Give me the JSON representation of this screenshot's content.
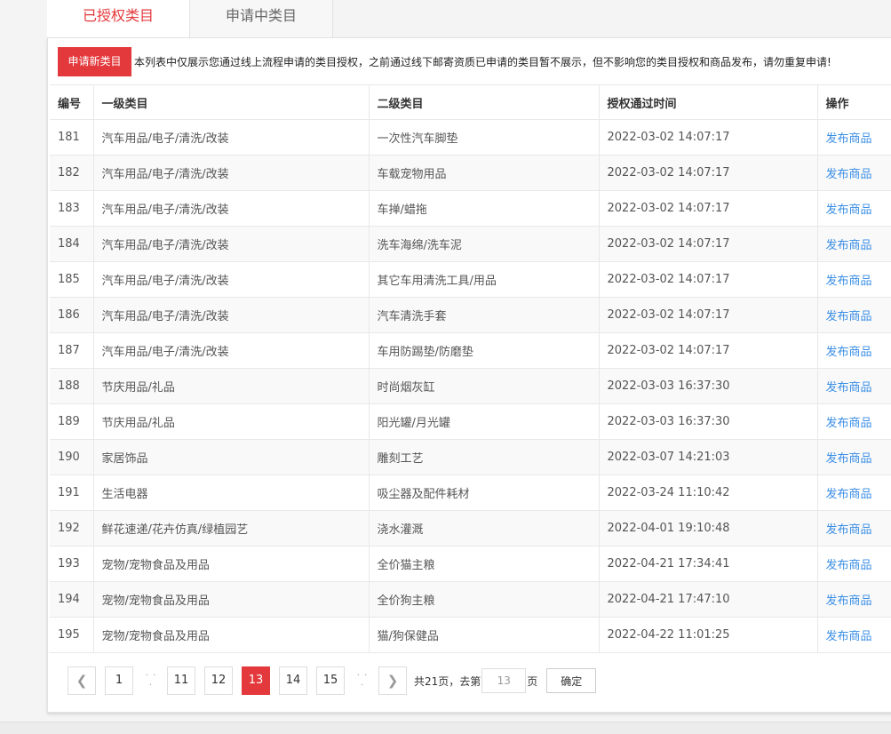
{
  "tabs": {
    "authorized": "已授权类目",
    "applying": "申请中类目"
  },
  "notice": {
    "apply_button": "申请新类目",
    "text": "本列表中仅展示您通过线上流程申请的类目授权，之前通过线下邮寄资质已申请的类目暂不展示，但不影响您的类目授权和商品发布，请勿重复申请!"
  },
  "table": {
    "headers": {
      "id": "编号",
      "cat1": "一级类目",
      "cat2": "二级类目",
      "time": "授权通过时间",
      "action": "操作"
    },
    "rows": [
      {
        "id": "181",
        "cat1": "汽车用品/电子/清洗/改装",
        "cat2": "一次性汽车脚垫",
        "time": "2022-03-02 14:07:17",
        "action": "发布商品"
      },
      {
        "id": "182",
        "cat1": "汽车用品/电子/清洗/改装",
        "cat2": "车载宠物用品",
        "time": "2022-03-02 14:07:17",
        "action": "发布商品"
      },
      {
        "id": "183",
        "cat1": "汽车用品/电子/清洗/改装",
        "cat2": "车掸/蜡拖",
        "time": "2022-03-02 14:07:17",
        "action": "发布商品"
      },
      {
        "id": "184",
        "cat1": "汽车用品/电子/清洗/改装",
        "cat2": "洗车海绵/洗车泥",
        "time": "2022-03-02 14:07:17",
        "action": "发布商品"
      },
      {
        "id": "185",
        "cat1": "汽车用品/电子/清洗/改装",
        "cat2": "其它车用清洗工具/用品",
        "time": "2022-03-02 14:07:17",
        "action": "发布商品"
      },
      {
        "id": "186",
        "cat1": "汽车用品/电子/清洗/改装",
        "cat2": "汽车清洗手套",
        "time": "2022-03-02 14:07:17",
        "action": "发布商品"
      },
      {
        "id": "187",
        "cat1": "汽车用品/电子/清洗/改装",
        "cat2": "车用防踢垫/防磨垫",
        "time": "2022-03-02 14:07:17",
        "action": "发布商品"
      },
      {
        "id": "188",
        "cat1": "节庆用品/礼品",
        "cat2": "时尚烟灰缸",
        "time": "2022-03-03 16:37:30",
        "action": "发布商品"
      },
      {
        "id": "189",
        "cat1": "节庆用品/礼品",
        "cat2": "阳光罐/月光罐",
        "time": "2022-03-03 16:37:30",
        "action": "发布商品"
      },
      {
        "id": "190",
        "cat1": "家居饰品",
        "cat2": "雕刻工艺",
        "time": "2022-03-07 14:21:03",
        "action": "发布商品"
      },
      {
        "id": "191",
        "cat1": "生活电器",
        "cat2": "吸尘器及配件耗材",
        "time": "2022-03-24 11:10:42",
        "action": "发布商品"
      },
      {
        "id": "192",
        "cat1": "鲜花速递/花卉仿真/绿植园艺",
        "cat2": "浇水灌溉",
        "time": "2022-04-01 19:10:48",
        "action": "发布商品"
      },
      {
        "id": "193",
        "cat1": "宠物/宠物食品及用品",
        "cat2": "全价猫主粮",
        "time": "2022-04-21 17:34:41",
        "action": "发布商品"
      },
      {
        "id": "194",
        "cat1": "宠物/宠物食品及用品",
        "cat2": "全价狗主粮",
        "time": "2022-04-21 17:47:10",
        "action": "发布商品"
      },
      {
        "id": "195",
        "cat1": "宠物/宠物食品及用品",
        "cat2": "猫/狗保健品",
        "time": "2022-04-22 11:01:25",
        "action": "发布商品"
      }
    ]
  },
  "pagination": {
    "prev_icon": "chevron-left-icon",
    "next_icon": "chevron-right-icon",
    "pages": [
      "1",
      "11",
      "12",
      "13",
      "14",
      "15"
    ],
    "current": "13",
    "ellipsis": "· · ·",
    "total_text": "共21页，去第",
    "goto_value": "13",
    "page_suffix": "页",
    "confirm_label": "确定"
  }
}
